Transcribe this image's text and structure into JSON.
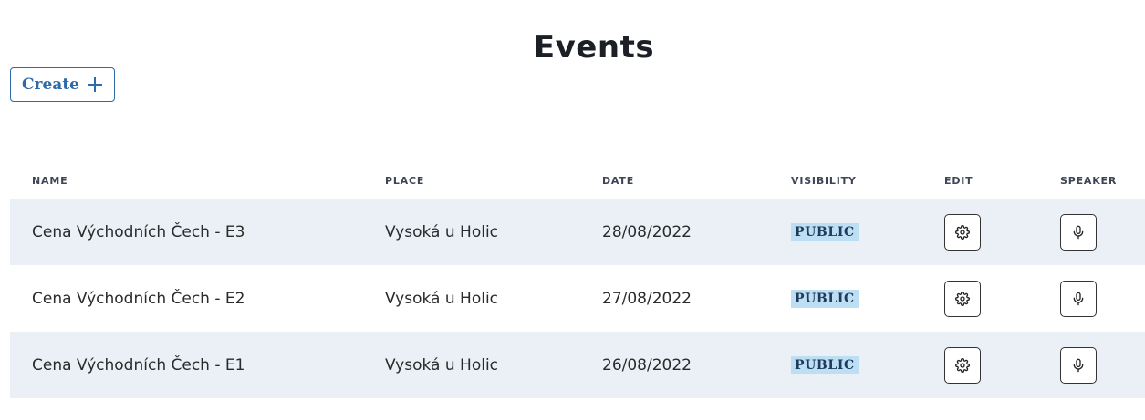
{
  "page": {
    "title": "Events"
  },
  "toolbar": {
    "create_label": "Create",
    "create_icon": "plus-icon"
  },
  "table": {
    "headers": {
      "name": "NAME",
      "place": "PLACE",
      "date": "DATE",
      "visibility": "VISIBILITY",
      "edit": "EDIT",
      "speaker": "SPEAKER"
    },
    "rows": [
      {
        "name": "Cena Východních Čech - E3",
        "place": "Vysoká u Holic",
        "date": "28/08/2022",
        "visibility": "PUBLIC",
        "edit_icon": "gear-icon",
        "speaker_icon": "microphone-icon"
      },
      {
        "name": "Cena Východních Čech - E2",
        "place": "Vysoká u Holic",
        "date": "27/08/2022",
        "visibility": "PUBLIC",
        "edit_icon": "gear-icon",
        "speaker_icon": "microphone-icon"
      },
      {
        "name": "Cena Východních Čech - E1",
        "place": "Vysoká u Holic",
        "date": "26/08/2022",
        "visibility": "PUBLIC",
        "edit_icon": "gear-icon",
        "speaker_icon": "microphone-icon"
      }
    ]
  },
  "colors": {
    "accent": "#2f6aa8",
    "row_shade": "#eaf0f5",
    "badge_bg": "#bcdff3",
    "badge_text": "#1f3a5c"
  }
}
